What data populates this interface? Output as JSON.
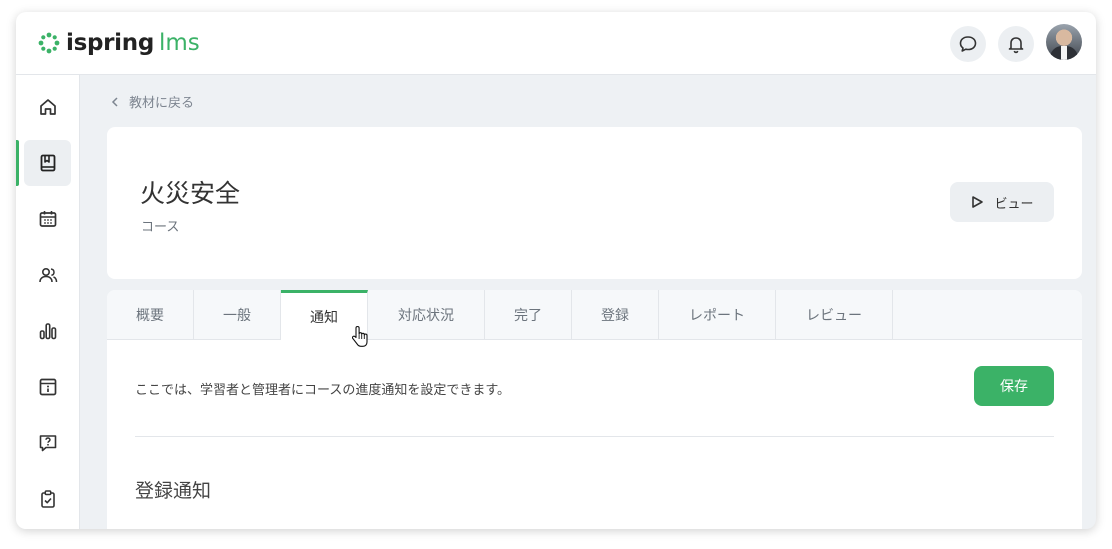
{
  "header": {
    "logo_word1": "ispring",
    "logo_word2": "lms",
    "chat_icon": "chat-bubble-icon",
    "bell_icon": "bell-icon"
  },
  "sidebar": {
    "items": [
      {
        "icon": "home-icon"
      },
      {
        "icon": "book-icon",
        "active": true
      },
      {
        "icon": "calendar-icon"
      },
      {
        "icon": "users-icon"
      },
      {
        "icon": "bar-chart-icon"
      },
      {
        "icon": "info-card-icon"
      },
      {
        "icon": "question-icon"
      },
      {
        "icon": "clipboard-check-icon"
      }
    ]
  },
  "breadcrumb": {
    "back_label": "教材に戻る"
  },
  "course": {
    "title": "火災安全",
    "type": "コース",
    "view_button": "ビュー"
  },
  "tabs": [
    {
      "label": "概要"
    },
    {
      "label": "一般"
    },
    {
      "label": "通知",
      "active": true
    },
    {
      "label": "対応状況"
    },
    {
      "label": "完了"
    },
    {
      "label": "登録"
    },
    {
      "label": "レポート"
    },
    {
      "label": "レビュー"
    }
  ],
  "content": {
    "description": "ここでは、学習者と管理者にコースの進度通知を設定できます。",
    "save_button": "保存",
    "section_title": "登録通知"
  },
  "colors": {
    "accent": "#3bb267",
    "background": "#eef1f4"
  }
}
